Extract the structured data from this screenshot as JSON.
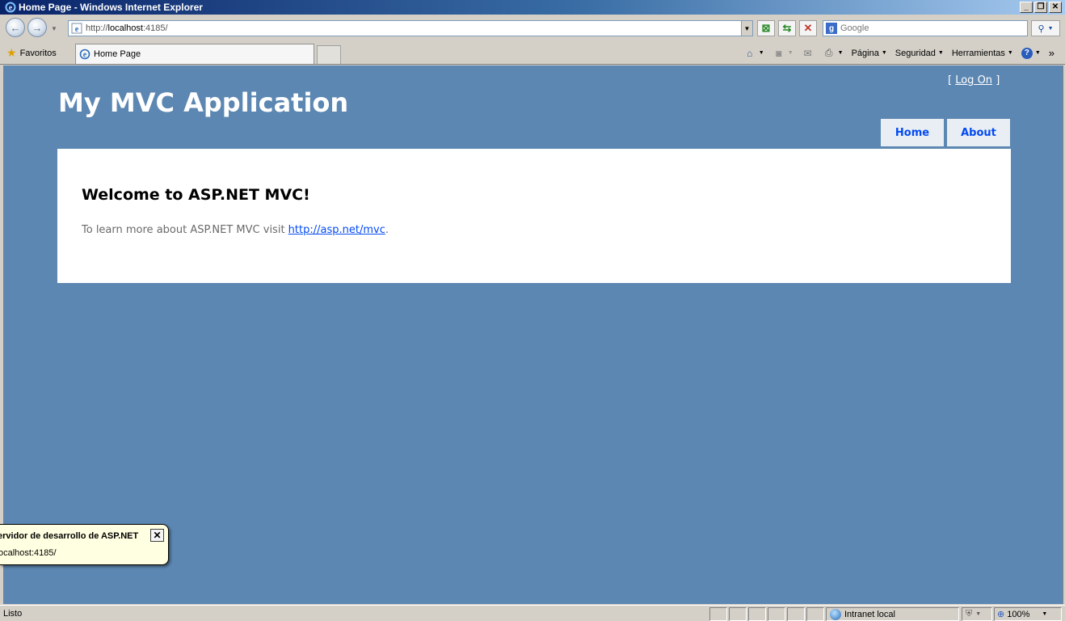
{
  "window": {
    "title": "Home Page - Windows Internet Explorer",
    "min_label": "_",
    "max_label": "❐",
    "close_label": "✕"
  },
  "addressbar": {
    "url_prefix": "http://",
    "url_host": "localhost",
    "url_suffix": ":4185/",
    "search_placeholder": "Google"
  },
  "toolbar": {
    "favorites_label": "Favoritos",
    "tab_title": "Home Page",
    "page_menu": "Página",
    "safety_menu": "Seguridad",
    "tools_menu": "Herramientas",
    "more_label": "»"
  },
  "page": {
    "logon_open": "[",
    "logon_link": "Log On",
    "logon_close": "]",
    "app_title": "My MVC Application",
    "menu": [
      {
        "label": "Home"
      },
      {
        "label": "About"
      }
    ],
    "heading": "Welcome to ASP.NET MVC!",
    "body_text": "To learn more about ASP.NET MVC visit ",
    "body_link": "http://asp.net/mvc",
    "body_end": "."
  },
  "notification": {
    "title": "ervidor de desarrollo de ASP.NET",
    "text": "ocalhost:4185/",
    "close_label": "✕"
  },
  "statusbar": {
    "status": "Listo",
    "zone": "Intranet local",
    "zoom": "100%"
  },
  "colors": {
    "page_background": "#5c87b2",
    "menu_link": "#034af3",
    "menu_background": "#e8eef4",
    "balloon": "#ffffe1"
  }
}
